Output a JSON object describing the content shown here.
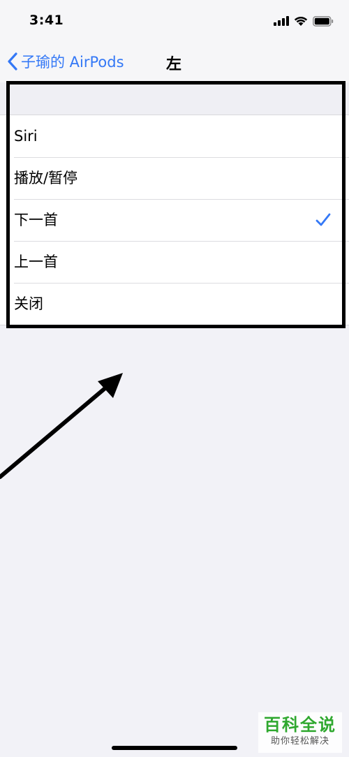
{
  "status_bar": {
    "time": "3:41",
    "icons": [
      "cellular-signal-icon",
      "wifi-icon",
      "battery-icon"
    ]
  },
  "nav": {
    "back_label": "子瑜的 AirPods",
    "title": "左"
  },
  "options": [
    {
      "label": "Siri",
      "selected": false
    },
    {
      "label": "播放/暂停",
      "selected": false
    },
    {
      "label": "下一首",
      "selected": true
    },
    {
      "label": "上一首",
      "selected": false
    },
    {
      "label": "关闭",
      "selected": false
    }
  ],
  "watermark": {
    "title": "百科全说",
    "subtitle": "助你轻松解决"
  },
  "colors": {
    "accent": "#3478f6",
    "background": "#f2f2f7",
    "row_background": "#ffffff",
    "watermark_green": "#2fa82f"
  }
}
